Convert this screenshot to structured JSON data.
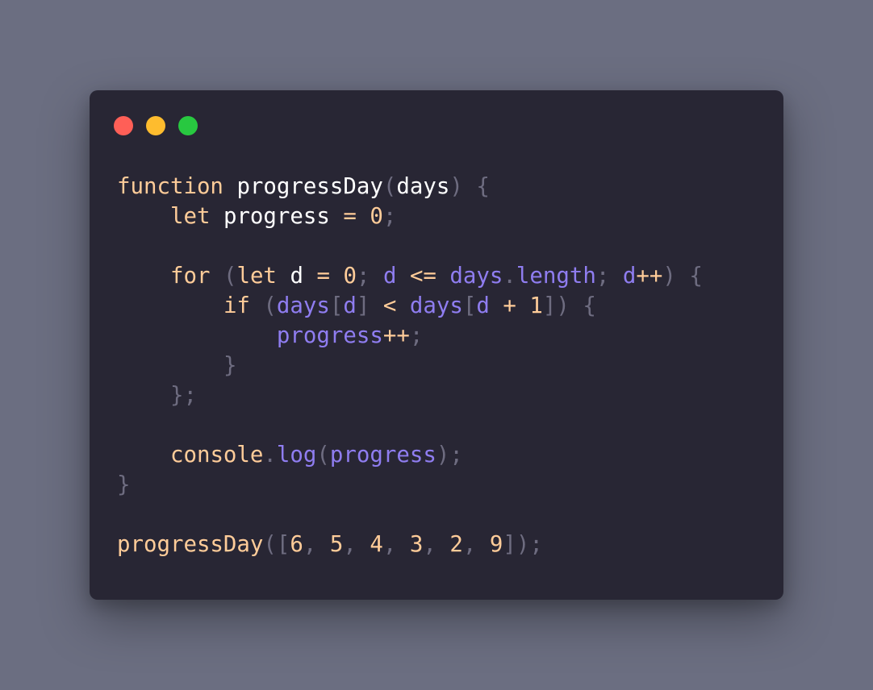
{
  "colors": {
    "background": "#6b6e81",
    "window": "#282634",
    "dot_close": "#ff5f57",
    "dot_minimize": "#febc2e",
    "dot_maximize": "#28c840",
    "keyword": "#ffcc99",
    "identifier": "#ffffff",
    "variable": "#8f7df0",
    "punctuation": "#6e6c80",
    "number": "#ffcc99",
    "operator": "#ffcc99"
  },
  "window": {
    "buttons": [
      {
        "name": "close-button",
        "color": "#ff5f57"
      },
      {
        "name": "minimize-button",
        "color": "#febc2e"
      },
      {
        "name": "maximize-button",
        "color": "#28c840"
      }
    ]
  },
  "code": {
    "lines": [
      {
        "indent": 0,
        "tokens": [
          [
            "function",
            "keyword"
          ],
          [
            " ",
            "plain"
          ],
          [
            "progressDay",
            "identifier"
          ],
          [
            "(",
            "punctuation"
          ],
          [
            "days",
            "identifier"
          ],
          [
            ")",
            "punctuation"
          ],
          [
            " ",
            "plain"
          ],
          [
            "{",
            "punctuation"
          ]
        ]
      },
      {
        "indent": 1,
        "tokens": [
          [
            "let",
            "keyword"
          ],
          [
            " ",
            "plain"
          ],
          [
            "progress",
            "identifier"
          ],
          [
            " ",
            "plain"
          ],
          [
            "=",
            "operator"
          ],
          [
            " ",
            "plain"
          ],
          [
            "0",
            "number"
          ],
          [
            ";",
            "punctuation"
          ]
        ]
      },
      {
        "indent": 0,
        "tokens": []
      },
      {
        "indent": 1,
        "tokens": [
          [
            "for",
            "keyword"
          ],
          [
            " ",
            "plain"
          ],
          [
            "(",
            "punctuation"
          ],
          [
            "let",
            "keyword"
          ],
          [
            " ",
            "plain"
          ],
          [
            "d",
            "identifier"
          ],
          [
            " ",
            "plain"
          ],
          [
            "=",
            "operator"
          ],
          [
            " ",
            "plain"
          ],
          [
            "0",
            "number"
          ],
          [
            ";",
            "punctuation"
          ],
          [
            " ",
            "plain"
          ],
          [
            "d",
            "variable"
          ],
          [
            " ",
            "plain"
          ],
          [
            "<=",
            "operator"
          ],
          [
            " ",
            "plain"
          ],
          [
            "days",
            "variable"
          ],
          [
            ".",
            "punctuation"
          ],
          [
            "length",
            "variable"
          ],
          [
            ";",
            "punctuation"
          ],
          [
            " ",
            "plain"
          ],
          [
            "d",
            "variable"
          ],
          [
            "++",
            "operator"
          ],
          [
            ")",
            "punctuation"
          ],
          [
            " ",
            "plain"
          ],
          [
            "{",
            "punctuation"
          ]
        ]
      },
      {
        "indent": 2,
        "tokens": [
          [
            "if",
            "keyword"
          ],
          [
            " ",
            "plain"
          ],
          [
            "(",
            "punctuation"
          ],
          [
            "days",
            "variable"
          ],
          [
            "[",
            "punctuation"
          ],
          [
            "d",
            "variable"
          ],
          [
            "]",
            "punctuation"
          ],
          [
            " ",
            "plain"
          ],
          [
            "<",
            "operator"
          ],
          [
            " ",
            "plain"
          ],
          [
            "days",
            "variable"
          ],
          [
            "[",
            "punctuation"
          ],
          [
            "d",
            "variable"
          ],
          [
            " ",
            "plain"
          ],
          [
            "+",
            "operator"
          ],
          [
            " ",
            "plain"
          ],
          [
            "1",
            "number"
          ],
          [
            "])",
            "punctuation"
          ],
          [
            " ",
            "plain"
          ],
          [
            "{",
            "punctuation"
          ]
        ]
      },
      {
        "indent": 3,
        "tokens": [
          [
            "progress",
            "variable"
          ],
          [
            "++",
            "operator"
          ],
          [
            ";",
            "punctuation"
          ]
        ]
      },
      {
        "indent": 2,
        "tokens": [
          [
            "}",
            "punctuation"
          ]
        ]
      },
      {
        "indent": 1,
        "tokens": [
          [
            "};",
            "punctuation"
          ]
        ]
      },
      {
        "indent": 0,
        "tokens": []
      },
      {
        "indent": 1,
        "tokens": [
          [
            "console",
            "keyword"
          ],
          [
            ".",
            "punctuation"
          ],
          [
            "log",
            "variable"
          ],
          [
            "(",
            "punctuation"
          ],
          [
            "progress",
            "variable"
          ],
          [
            ");",
            "punctuation"
          ]
        ]
      },
      {
        "indent": 0,
        "tokens": [
          [
            "}",
            "punctuation"
          ]
        ]
      },
      {
        "indent": 0,
        "tokens": []
      },
      {
        "indent": 0,
        "tokens": [
          [
            "progressDay",
            "keyword"
          ],
          [
            "([",
            "punctuation"
          ],
          [
            "6",
            "number"
          ],
          [
            ",",
            "punctuation"
          ],
          [
            " ",
            "plain"
          ],
          [
            "5",
            "number"
          ],
          [
            ",",
            "punctuation"
          ],
          [
            " ",
            "plain"
          ],
          [
            "4",
            "number"
          ],
          [
            ",",
            "punctuation"
          ],
          [
            " ",
            "plain"
          ],
          [
            "3",
            "number"
          ],
          [
            ",",
            "punctuation"
          ],
          [
            " ",
            "plain"
          ],
          [
            "2",
            "number"
          ],
          [
            ",",
            "punctuation"
          ],
          [
            " ",
            "plain"
          ],
          [
            "9",
            "number"
          ],
          [
            "]);",
            "punctuation"
          ]
        ]
      }
    ]
  }
}
